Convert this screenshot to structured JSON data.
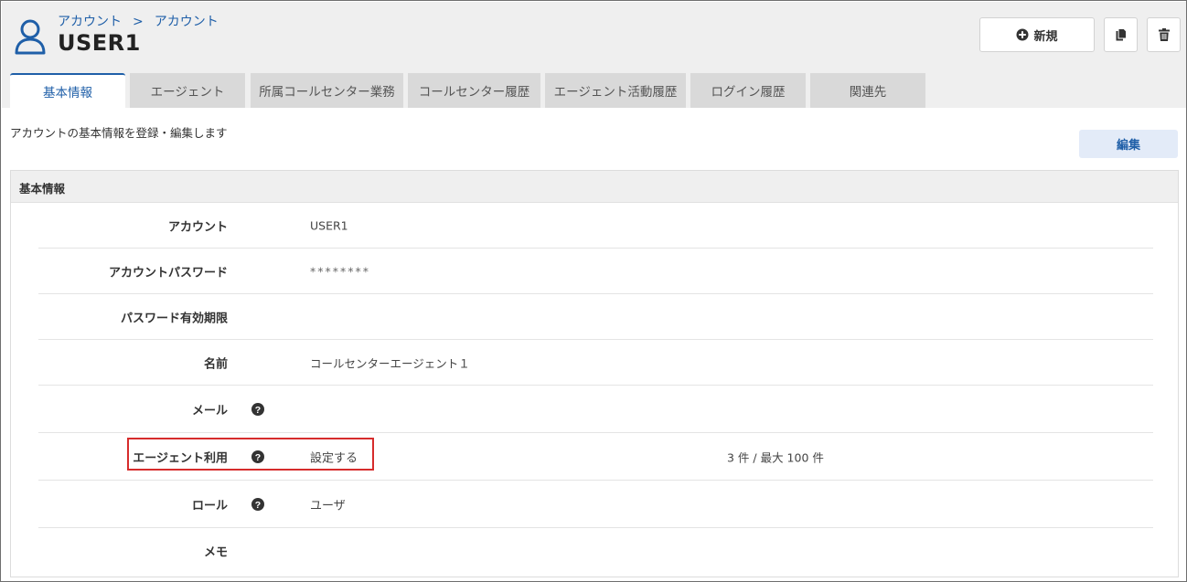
{
  "breadcrumb": {
    "parent": "アカウント",
    "separator": ">",
    "current": "アカウント"
  },
  "page_title": "USER1",
  "toolbar": {
    "new_label": "新規",
    "copy_icon": "copy-icon",
    "delete_icon": "trash-icon"
  },
  "tabs": [
    {
      "label": "基本情報",
      "active": true
    },
    {
      "label": "エージェント"
    },
    {
      "label": "所属コールセンター業務"
    },
    {
      "label": "コールセンター履歴"
    },
    {
      "label": "エージェント活動履歴"
    },
    {
      "label": "ログイン履歴"
    },
    {
      "label": "関連先"
    }
  ],
  "description": "アカウントの基本情報を登録・編集します",
  "edit_label": "編集",
  "panel": {
    "title": "基本情報",
    "fields": [
      {
        "label": "アカウント",
        "value": "USER1"
      },
      {
        "label": "アカウントパスワード",
        "value": "********"
      },
      {
        "label": "パスワード有効期限",
        "value": ""
      },
      {
        "label": "名前",
        "value": "コールセンターエージェント１"
      },
      {
        "label": "メール",
        "value": ""
      },
      {
        "label": "エージェント利用",
        "value": "設定する",
        "extra": "3 件 / 最大 100 件"
      },
      {
        "label": "ロール",
        "value": "ユーザ"
      },
      {
        "label": "メモ",
        "value": ""
      }
    ]
  },
  "colors": {
    "accent": "#1f5fa8",
    "highlight": "#d62c2c",
    "header_bg": "#efefef",
    "tab_bg": "#d9d9d9"
  }
}
